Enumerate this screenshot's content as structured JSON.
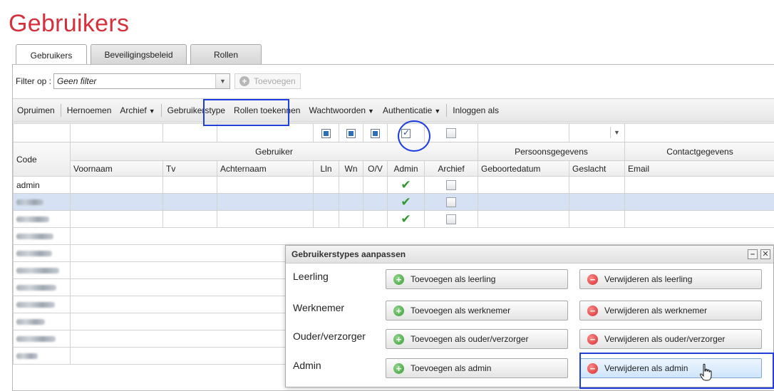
{
  "page": {
    "title": "Gebruikers"
  },
  "tabs": [
    "Gebruikers",
    "Beveiligingsbeleid",
    "Rollen"
  ],
  "filter": {
    "label": "Filter op :",
    "value": "Geen filter",
    "add_label": "Toevoegen"
  },
  "toolbar": {
    "opruimen": "Opruimen",
    "hernoemen": "Hernoemen",
    "archief": "Archief",
    "gebruikerstype": "Gebruikerstype",
    "rollen": "Rollen toekennen",
    "wachtwoorden": "Wachtwoorden",
    "authenticatie": "Authenticatie",
    "inloggen": "Inloggen als"
  },
  "grid": {
    "group_headers": {
      "code": "Code",
      "gebruiker": "Gebruiker",
      "persoon": "Persoonsgegevens",
      "contact": "Contactgegevens"
    },
    "columns": {
      "voornaam": "Voornaam",
      "tv": "Tv",
      "achternaam": "Achternaam",
      "lln": "Lln",
      "wn": "Wn",
      "ov": "O/V",
      "admin": "Admin",
      "archief": "Archief",
      "geboortedatum": "Geboortedatum",
      "geslacht": "Geslacht",
      "email": "Email"
    },
    "rows": [
      {
        "code": "admin",
        "admin": true
      },
      {
        "code": "",
        "admin": true,
        "selected": true
      },
      {
        "code": "",
        "admin": true
      }
    ]
  },
  "dialog": {
    "title": "Gebruikerstypes aanpassen",
    "rows": [
      {
        "label": "Leerling",
        "add": "Toevoegen als leerling",
        "remove": "Verwijderen als leerling"
      },
      {
        "label": "Werknemer",
        "add": "Toevoegen als werknemer",
        "remove": "Verwijderen als werknemer"
      },
      {
        "label": "Ouder/verzorger",
        "add": "Toevoegen als ouder/verzorger",
        "remove": "Verwijderen als ouder/verzorger"
      },
      {
        "label": "Admin",
        "add": "Toevoegen als admin",
        "remove": "Verwijderen als admin"
      }
    ]
  },
  "colors": {
    "title_red": "#d5303b",
    "highlight_blue": "#1e3ee0",
    "selection": "#d6e2f3"
  }
}
